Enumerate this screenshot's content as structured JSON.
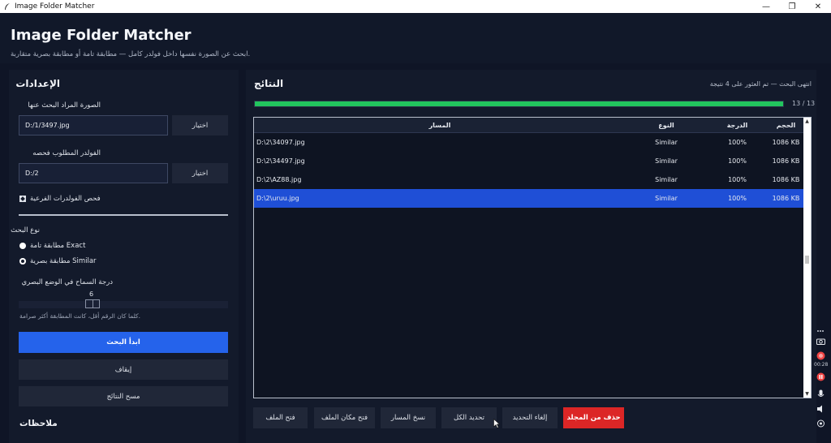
{
  "window": {
    "title": "Image Folder Matcher"
  },
  "header": {
    "title": "Image Folder Matcher",
    "subtitle": "ابحث عن الصورة نفسها داخل فولدر كامل — مطابقة تامة أو مطابقة بصرية متقاربة."
  },
  "settings": {
    "title": "الإعدادات",
    "image_label": "الصورة المراد البحث عنها",
    "image_value": "D:/1/3497.jpg",
    "pick_label": "اختيار",
    "folder_label": "الفولدر المطلوب فحصه",
    "folder_value": "D:/2",
    "subfolders_label": "فحص الفولدرات الفرعية",
    "search_type_label": "نوع البحث",
    "radio_exact": "مطابقة تامة Exact",
    "radio_similar": "مطابقة بصرية Similar",
    "selected_mode": "Similar",
    "tolerance_label": "درجة السماح في الوضع البصري",
    "tolerance_value": "6",
    "tolerance_hint": "كلما كان الرقم أقل، كانت المطابقة أكثر صرامة.",
    "start_button": "ابدأ البحث",
    "stop_button": "إيقاف",
    "clear_button": "مسح النتائج",
    "notes_title": "ملاحظات"
  },
  "results": {
    "title": "النتائج",
    "status": "انتهى البحث — تم العثور على 4 نتيجة",
    "progress_done": 13,
    "progress_total": 13,
    "progress_text": "13 / 13",
    "columns": {
      "path": "المسار",
      "type": "النوع",
      "score": "الدرجة",
      "size": "الحجم"
    },
    "rows": [
      {
        "path": "D:\\2\\34097.jpg",
        "type": "Similar",
        "score": "100%",
        "size": "1086 KB",
        "selected": false
      },
      {
        "path": "D:\\2\\34497.jpg",
        "type": "Similar",
        "score": "100%",
        "size": "1086 KB",
        "selected": false
      },
      {
        "path": "D:\\2\\AZ88.jpg",
        "type": "Similar",
        "score": "100%",
        "size": "1086 KB",
        "selected": false
      },
      {
        "path": "D:\\2\\uruu.jpg",
        "type": "Similar",
        "score": "100%",
        "size": "1086 KB",
        "selected": true
      }
    ],
    "actions": {
      "open_file": "فتح الملف",
      "open_location": "فتح مكان الملف",
      "copy_path": "نسخ المسار",
      "select_all": "تحديد الكل",
      "deselect": "إلغاء التحديد",
      "delete": "حذف من المجلد"
    }
  },
  "recorder": {
    "time": "00:28"
  },
  "colors": {
    "accent": "#2563eb",
    "progress": "#22c55e",
    "danger": "#dc2626",
    "selection": "#1f4fd6"
  },
  "icons": [
    "app-feather-icon",
    "minimize-icon",
    "maximize-icon",
    "close-icon",
    "camera-icon",
    "record-icon",
    "pause-icon",
    "mic-icon",
    "speaker-icon",
    "webcam-icon"
  ]
}
